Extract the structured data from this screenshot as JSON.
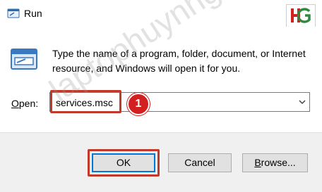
{
  "window": {
    "title": "Run",
    "icon": "run-icon"
  },
  "logo": {
    "letters": "HG",
    "tagline": "laptophuynhgia.com"
  },
  "dialog": {
    "description": "Type the name of a program, folder, document, or Internet resource, and Windows will open it for you.",
    "open_label": "Open:",
    "open_accesskey": "O",
    "open_rest": "pen:",
    "input_value": "services.msc"
  },
  "annotations": {
    "step_number": "1",
    "highlight_color": "#c0392b",
    "badge_color": "#d1201f"
  },
  "buttons": {
    "ok_label": "OK",
    "cancel_label": "Cancel",
    "browse_accesskey": "B",
    "browse_rest": "rowse..."
  },
  "watermark": "laptophuynhgia.com"
}
